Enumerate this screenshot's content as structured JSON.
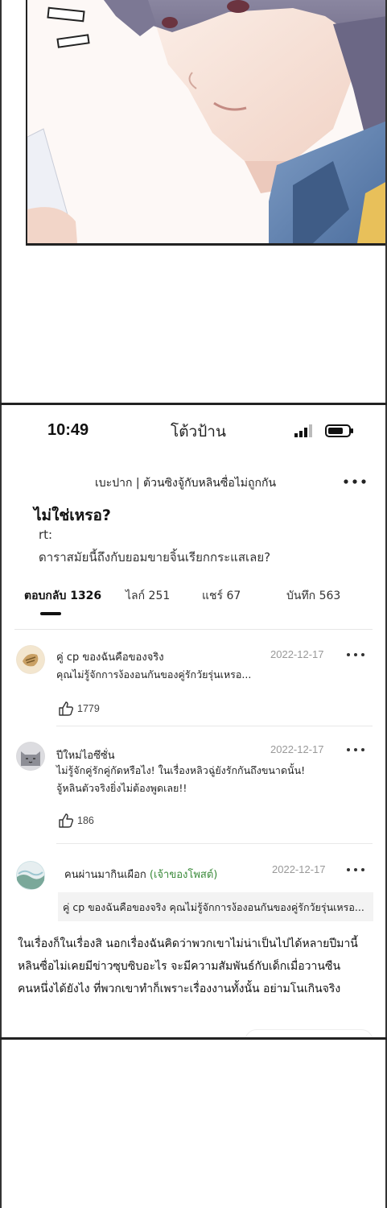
{
  "status_bar": {
    "time": "10:49",
    "app_title": "โต้วป้าน"
  },
  "topic": {
    "text": "เบะปาก | ต้วนซิงจู้กับหลินซื่อไม่ถูกกัน"
  },
  "post": {
    "title": "ไม่ใช่เหรอ?",
    "rt": "rt:",
    "body": "ดาราสมัยนี้ถึงกับยอมขายจิ้นเรียกกระแสเลย?"
  },
  "tabs": [
    {
      "label": "ตอบกลับ 1326",
      "active": true
    },
    {
      "label": "ไลก์ 251",
      "active": false
    },
    {
      "label": "แชร์ 67",
      "active": false
    },
    {
      "label": "บันทึก 563",
      "active": false
    }
  ],
  "comments": [
    {
      "name": "คู่ cp ของฉันคือของจริง",
      "date": "2022-12-17",
      "lines": [
        "คุณไม่รู้จักการง้องอนกันของคู่รักวัยรุ่นเหรอ..."
      ],
      "likes": "1779",
      "avatar": "sticker-avatar"
    },
    {
      "name": "ปีใหม่ไอซึซั่น",
      "date": "2022-12-17",
      "lines": [
        "ไม่รู้จักคู่รักคู่กัดหรือไง! ในเรื่องหลิวฉู่ยังรักกันถึงขนาดนั้น!",
        "จู้หลินตัวจริงยิ่งไม่ต้องพูดเลย!!"
      ],
      "likes": "186",
      "avatar": "cat-avatar"
    },
    {
      "name": "คนผ่านมากินเผือก",
      "op_tag": "(เจ้าของโพสต์)",
      "date": "2022-12-17",
      "quote": "คู่ cp ของฉันคือของจริง คุณไม่รู้จักการง้องอนกันของคู่รักวัยรุ่นเหรอ...",
      "avatar": "wave-avatar"
    }
  ],
  "reply_body": [
    "ในเรื่องก็ในเรื่องสิ นอกเรื่องฉันคิดว่าพวกเขาไม่น่าเป็นไปได้หลายปีมานี้",
    "หลินซื่อไม่เคยมีข่าวซุบซิบอะไร จะมีความสัมพันธ์กับเด็กเมื่อวานซืน",
    "คนหนึ่งได้ยังไง ที่พวกเขาทำก็เพราะเรื่องงานทั้งนั้น อย่ามโนเกินจริง"
  ],
  "colors": {
    "op_tag": "#3a8a3a",
    "date": "#999999",
    "hair": "#6f6a86",
    "jacket": "#5a7fb0"
  }
}
